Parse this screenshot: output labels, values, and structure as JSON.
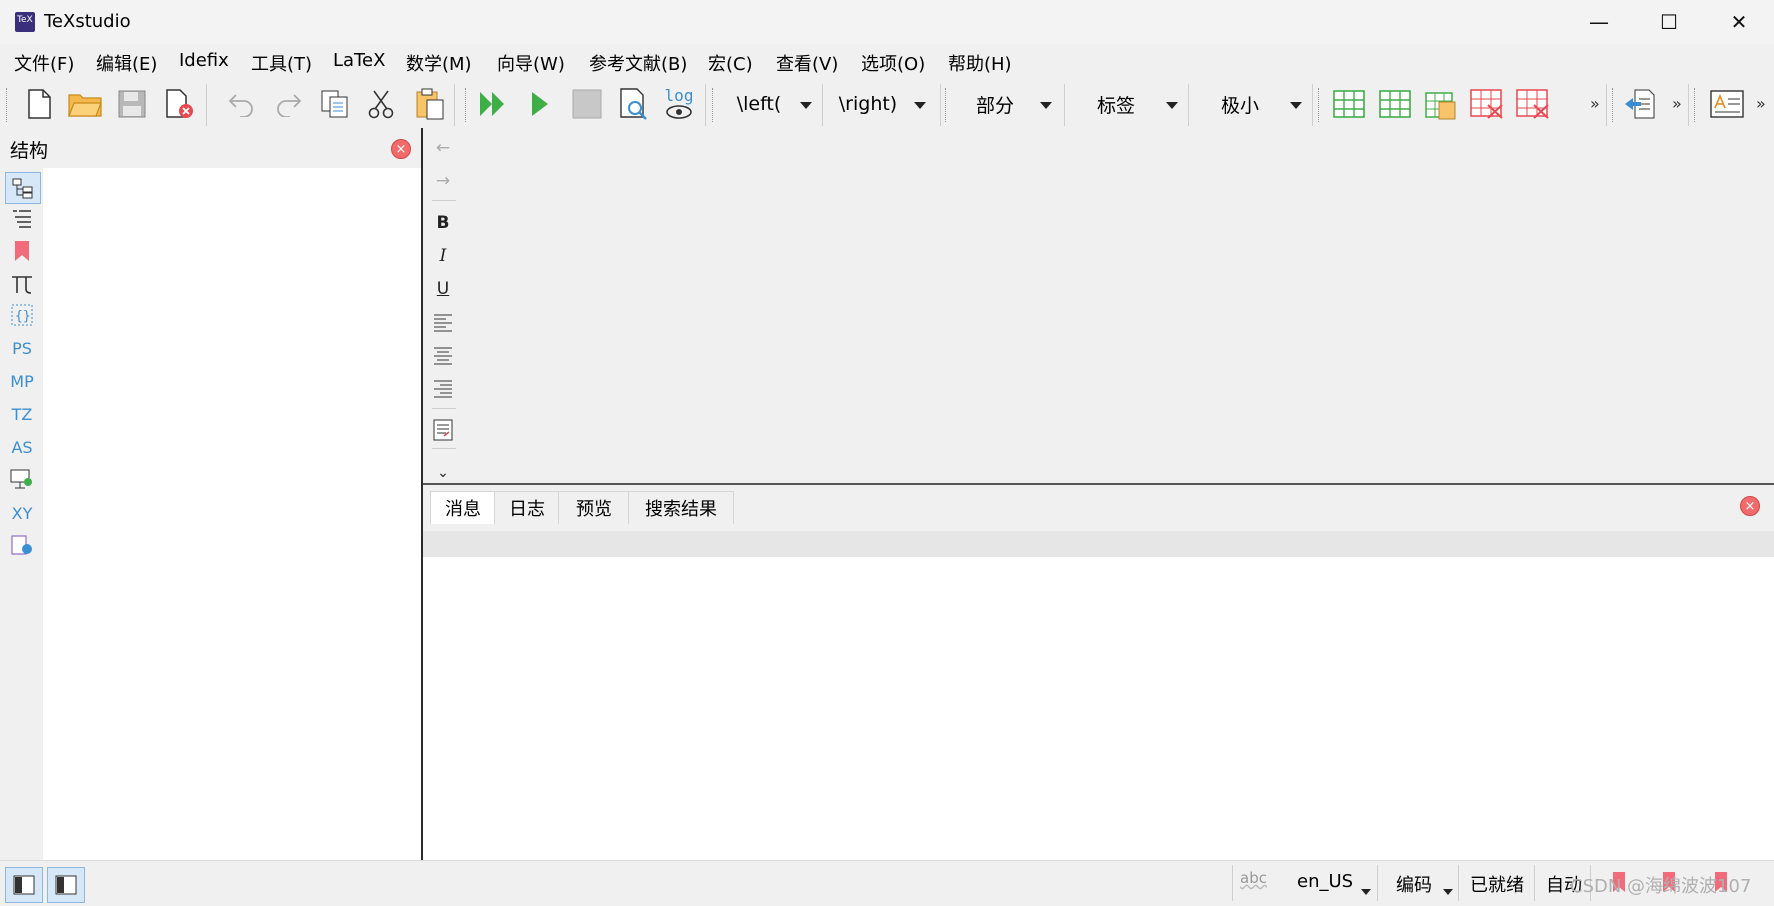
{
  "window": {
    "title": "TeXstudio",
    "minimize": "—",
    "maximize": "☐",
    "close": "✕"
  },
  "menu": [
    "文件(F)",
    "编辑(E)",
    "Idefix",
    "工具(T)",
    "LaTeX",
    "数学(M)",
    "向导(W)",
    "参考文献(B)",
    "宏(C)",
    "查看(V)",
    "选项(O)",
    "帮助(H)"
  ],
  "toolbar": {
    "log_label": "log",
    "left_delim": "\\left(",
    "right_delim": "\\right)",
    "section": "部分",
    "label": "标签",
    "size": "极小",
    "more": "»"
  },
  "structure": {
    "title": "结构",
    "side_items": [
      "PS",
      "MP",
      "TZ",
      "AS",
      "XY"
    ]
  },
  "editor_tools": {
    "back": "←",
    "forward": "→",
    "bold": "B",
    "italic": "I",
    "underline": "U",
    "more": "⌄"
  },
  "bottom_tabs": [
    "消息",
    "日志",
    "预览",
    "搜索结果"
  ],
  "status": {
    "spell": "abc",
    "language": "en_US",
    "encoding": "编码",
    "state": "已就绪",
    "mode": "自动",
    "watermark": "CSDN @海绵波波107"
  },
  "colors": {
    "accent_blue": "#3b8fd1",
    "green_run": "#3fae49",
    "close_red": "#f26b6b"
  }
}
